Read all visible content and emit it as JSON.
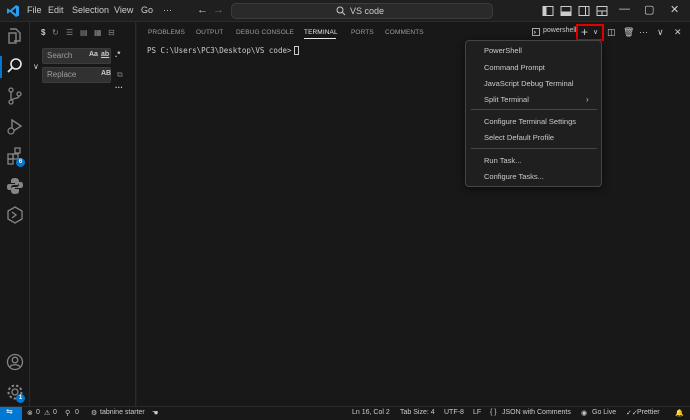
{
  "title_bar": {
    "menus": [
      "File",
      "Edit",
      "Selection",
      "View",
      "Go",
      "···"
    ],
    "command_center_text": "VS code",
    "window_controls": [
      "—",
      "▢",
      "✕"
    ]
  },
  "sidebar": {
    "search_placeholder": "Search",
    "replace_placeholder": "Replace",
    "match_case": "Aa",
    "whole_word": "ab",
    "regex": ".*",
    "preserve_case": "AB",
    "more": "···",
    "extensions_badge": "6",
    "accounts_badge": "1"
  },
  "panel": {
    "tabs": [
      "PROBLEMS",
      "OUTPUT",
      "DEBUG CONSOLE",
      "TERMINAL",
      "PORTS",
      "COMMENTS"
    ],
    "active_tab": "TERMINAL",
    "terminal_prompt": "PS C:\\Users\\PC3\\Desktop\\VS code>",
    "terminal_name": "powershell"
  },
  "dropdown": {
    "items": [
      "PowerShell",
      "Command Prompt",
      "JavaScript Debug Terminal",
      "Split Terminal",
      "Configure Terminal Settings",
      "Select Default Profile",
      "Run Task...",
      "Configure Tasks..."
    ]
  },
  "status_bar": {
    "errors": "0",
    "warnings": "0",
    "ports": "0",
    "tabnine": "tabnine starter",
    "position": "Ln 16, Col 2",
    "tab_size": "Tab Size: 4",
    "encoding": "UTF-8",
    "eol": "LF",
    "language": "JSON with Comments",
    "golive": "Go Live",
    "prettier": "Prettier"
  },
  "colors": {
    "accent": "#0078d4",
    "highlight_box": "#e00000",
    "background": "#1f1f1f"
  }
}
